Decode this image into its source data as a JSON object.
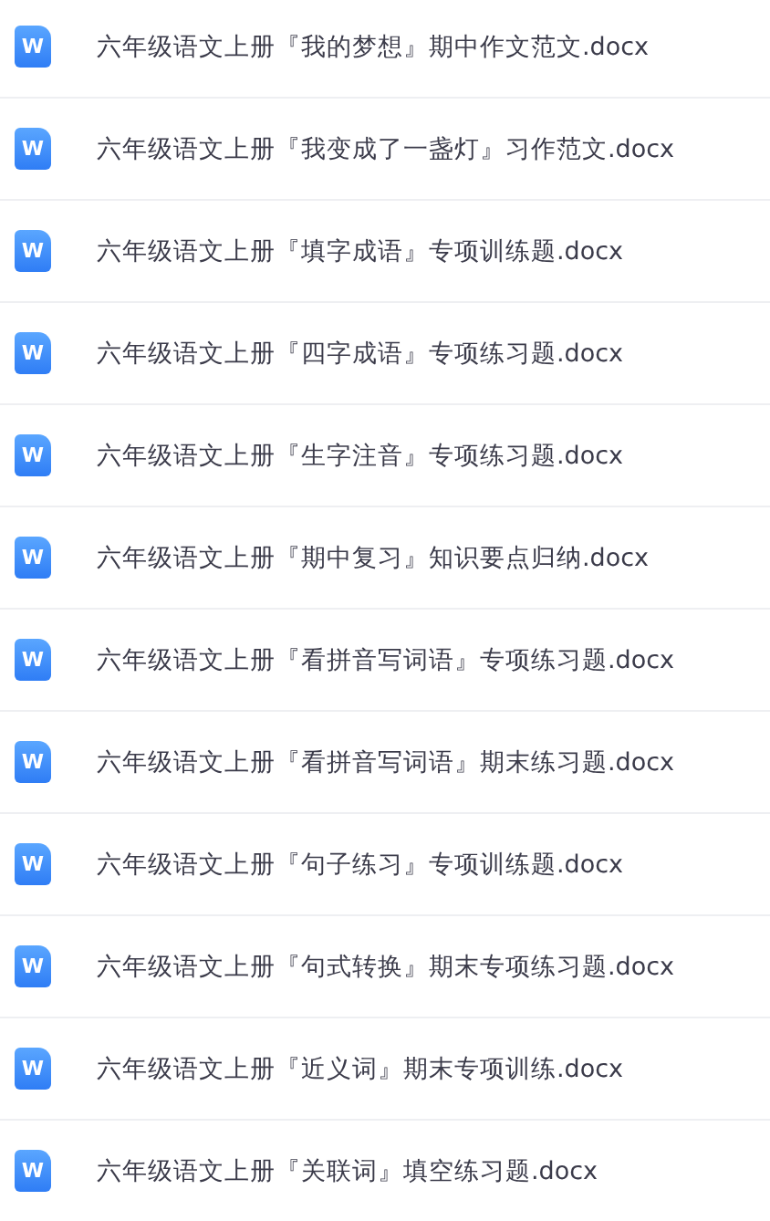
{
  "files": [
    {
      "name": "六年级语文上册『我的梦想』期中作文范文.docx",
      "icon_label": "W"
    },
    {
      "name": "六年级语文上册『我变成了一盏灯』习作范文.docx",
      "icon_label": "W"
    },
    {
      "name": "六年级语文上册『填字成语』专项训练题.docx",
      "icon_label": "W"
    },
    {
      "name": "六年级语文上册『四字成语』专项练习题.docx",
      "icon_label": "W"
    },
    {
      "name": "六年级语文上册『生字注音』专项练习题.docx",
      "icon_label": "W"
    },
    {
      "name": "六年级语文上册『期中复习』知识要点归纳.docx",
      "icon_label": "W"
    },
    {
      "name": "六年级语文上册『看拼音写词语』专项练习题.docx",
      "icon_label": "W"
    },
    {
      "name": "六年级语文上册『看拼音写词语』期末练习题.docx",
      "icon_label": "W"
    },
    {
      "name": "六年级语文上册『句子练习』专项训练题.docx",
      "icon_label": "W"
    },
    {
      "name": "六年级语文上册『句式转换』期末专项练习题.docx",
      "icon_label": "W"
    },
    {
      "name": "六年级语文上册『近义词』期末专项训练.docx",
      "icon_label": "W"
    },
    {
      "name": "六年级语文上册『关联词』填空练习题.docx",
      "icon_label": "W"
    }
  ]
}
